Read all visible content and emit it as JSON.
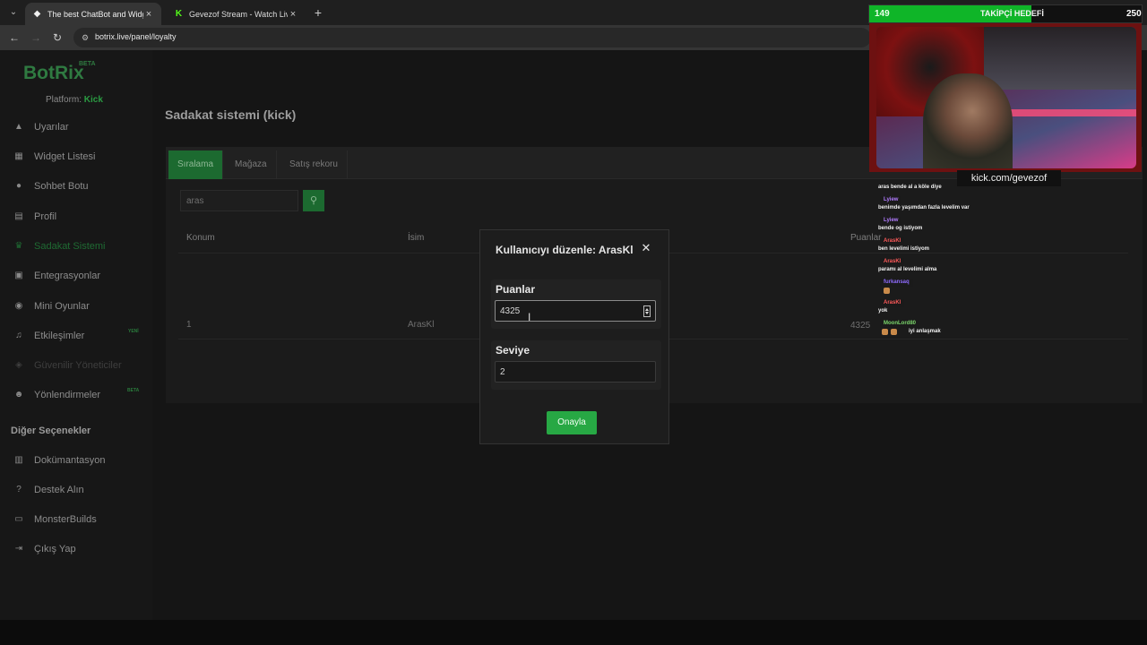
{
  "browser": {
    "tabs": [
      {
        "title": "The best ChatBot and Widgets",
        "favicon": "botrix-favicon-icon",
        "active": true
      },
      {
        "title": "Gevezof Stream - Watch Live on",
        "favicon": "kick-favicon-icon",
        "active": false
      }
    ],
    "url": "botrix.live/panel/loyalty"
  },
  "sidebar": {
    "logo": "BotRix",
    "logo_badge": "BETA",
    "platform_label": "Platform:",
    "platform_value": "Kick",
    "items": [
      {
        "label": "Uyarılar",
        "icon": "warning-icon"
      },
      {
        "label": "Widget Listesi",
        "icon": "list-icon"
      },
      {
        "label": "Sohbet Botu",
        "icon": "robot-icon"
      },
      {
        "label": "Profil",
        "icon": "profile-icon"
      },
      {
        "label": "Sadakat Sistemi",
        "icon": "trophy-icon",
        "active": true
      },
      {
        "label": "Entegrasyonlar",
        "icon": "integration-icon"
      },
      {
        "label": "Mini Oyunlar",
        "icon": "gamepad-icon"
      },
      {
        "label": "Etkileşimler",
        "icon": "music-icon",
        "badge": "YENİ"
      },
      {
        "label": "Güvenilir Yöneticiler",
        "icon": "user-shield-icon",
        "disabled": true
      },
      {
        "label": "Yönlendirmeler",
        "icon": "users-icon",
        "badge": "BETA"
      }
    ],
    "section_title": "Diğer Seçenekler",
    "other_items": [
      {
        "label": "Dokümantasyon",
        "icon": "book-icon"
      },
      {
        "label": "Destek Alın",
        "icon": "help-icon"
      },
      {
        "label": "MonsterBuilds",
        "icon": "desktop-icon"
      },
      {
        "label": "Çıkış Yap",
        "icon": "logout-icon"
      }
    ]
  },
  "main": {
    "title": "Sadakat sistemi (kick)",
    "tabs": [
      "Sıralama",
      "Mağaza",
      "Satış rekoru"
    ],
    "search_value": "aras",
    "columns": [
      "Konum",
      "İsim",
      "Puanlar"
    ],
    "rows": [
      {
        "position": "1",
        "name": "ArasKl",
        "points": "4325"
      }
    ]
  },
  "modal": {
    "title": "Kullanıcıyı düzenle: ArasKl",
    "points_label": "Puanlar",
    "points_value": "4325",
    "level_label": "Seviye",
    "level_value": "2",
    "confirm_label": "Onayla"
  },
  "overlay": {
    "goal_current": "149",
    "goal_label": "TAKİPÇİ HEDEFİ",
    "goal_target": "250",
    "goal_progress": 0.596,
    "handle": "kick.com/gevezof"
  },
  "chat": [
    {
      "type": "text",
      "text": "aras bende al a köle diye"
    },
    {
      "type": "name",
      "text": "Lyiew",
      "color": "#b27cff"
    },
    {
      "type": "text",
      "text": "benimde yaşımdan fazla levelim var"
    },
    {
      "type": "name",
      "text": "Lyiew",
      "color": "#b27cff"
    },
    {
      "type": "text",
      "text": "bende og istiyom"
    },
    {
      "type": "name",
      "text": "ArasKl",
      "color": "#ff5a5a"
    },
    {
      "type": "text",
      "text": "ben levelimi istiyom"
    },
    {
      "type": "name",
      "text": "ArasKl",
      "color": "#ff5a5a"
    },
    {
      "type": "text",
      "text": "paramı al levelimi alma"
    },
    {
      "type": "name",
      "text": "furkansaq",
      "color": "#8f6bff"
    },
    {
      "type": "name",
      "text": "ArasKl",
      "color": "#ff5a5a"
    },
    {
      "type": "text",
      "text": "yok"
    },
    {
      "type": "name",
      "text": "MoonLord80",
      "color": "#7bd66b"
    },
    {
      "type": "text",
      "text": "iyi anlaşmak"
    }
  ],
  "colors": {
    "accent_green": "#27a844",
    "goal_green": "#0fb528"
  }
}
